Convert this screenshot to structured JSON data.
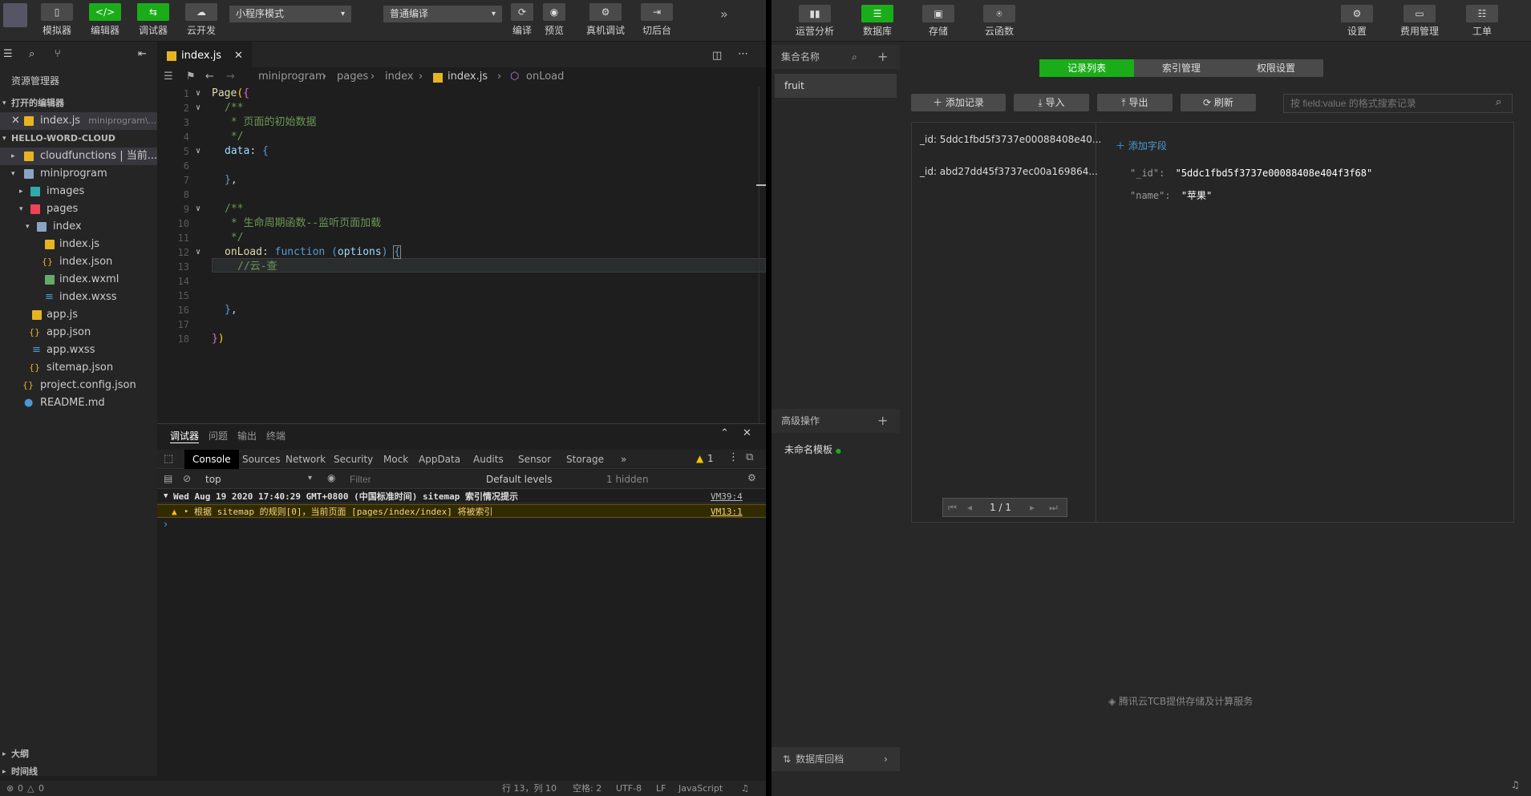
{
  "toolbar": {
    "simulator": "模拟器",
    "editor": "编辑器",
    "debugger": "调试器",
    "cloud": "云开发",
    "mode": "小程序模式",
    "compile_mode": "普通编译",
    "compile": "编译",
    "preview": "预览",
    "remote_debug": "真机调试",
    "backend": "切后台"
  },
  "sidebar": {
    "title": "资源管理器",
    "open_editors": "打开的编辑器",
    "open_file": "index.js",
    "open_file_path": "miniprogram\\...",
    "project": "HELLO-WORD-CLOUD",
    "tree": [
      "cloudfunctions | 当前...",
      "miniprogram",
      "images",
      "pages",
      "index",
      "index.js",
      "index.json",
      "index.wxml",
      "index.wxss",
      "app.js",
      "app.json",
      "app.wxss",
      "sitemap.json",
      "project.config.json",
      "README.md"
    ],
    "outline": "大纲",
    "timeline": "时间线"
  },
  "editor": {
    "tab": "index.js",
    "breadcrumb": [
      "miniprogram",
      "pages",
      "index",
      "index.js",
      "onLoad"
    ],
    "line_numbers": [
      "1",
      "2",
      "3",
      "4",
      "5",
      "6",
      "7",
      "8",
      "9",
      "10",
      "11",
      "12",
      "13",
      "14",
      "15",
      "16",
      "17",
      "18"
    ]
  },
  "panel": {
    "tabs": [
      "调试器",
      "问题",
      "输出",
      "终端"
    ],
    "devtabs": [
      "Console",
      "Sources",
      "Network",
      "Security",
      "Mock",
      "AppData",
      "Audits",
      "Sensor",
      "Storage"
    ],
    "warn_count": "1",
    "context": "top",
    "filter_placeholder": "Filter",
    "levels": "Default levels",
    "hidden": "1 hidden",
    "log_header": "Wed Aug 19 2020 17:40:29 GMT+0800 (中国标准时间) sitemap 索引情况提示",
    "log_header_src": "VM39:4",
    "log_warn": "根据 sitemap 的规则[0]，当前页面 [pages/index/index] 将被索引",
    "log_warn_src": "VM13:1"
  },
  "status": {
    "problems": "0",
    "warnings": "0",
    "position": "行 13，列 10",
    "spaces": "空格: 2",
    "encoding": "UTF-8",
    "eol": "LF",
    "language": "JavaScript"
  },
  "cloud": {
    "nav": [
      "运营分析",
      "数据库",
      "存储",
      "云函数"
    ],
    "nav_right": [
      "设置",
      "费用管理",
      "工单"
    ],
    "collections_title": "集合名称",
    "collections": [
      "fruit"
    ],
    "advanced_title": "高级操作",
    "template": "未命名模板",
    "rollback": "数据库回档",
    "segments": [
      "记录列表",
      "索引管理",
      "权限设置"
    ],
    "actions": [
      "添加记录",
      "导入",
      "导出",
      "刷新"
    ],
    "search_placeholder": "按 field:value 的格式搜索记录",
    "records": [
      "_id: 5ddc1fbd5f3737e00088408e40...",
      "_id: abd27dd45f3737ec00a169864..."
    ],
    "add_field": "添加字段",
    "fields": [
      {
        "key": "\"_id\":",
        "value": "\"5ddc1fbd5f3737e00088408e404f3f68\""
      },
      {
        "key": "\"name\":",
        "value": "\"苹果\""
      }
    ],
    "pagination": "1 / 1",
    "footer": "腾讯云TCB提供存储及计算服务"
  },
  "colors": {
    "accent": "#1aad19",
    "bg": "#1e1e1e",
    "panel": "#282828"
  }
}
